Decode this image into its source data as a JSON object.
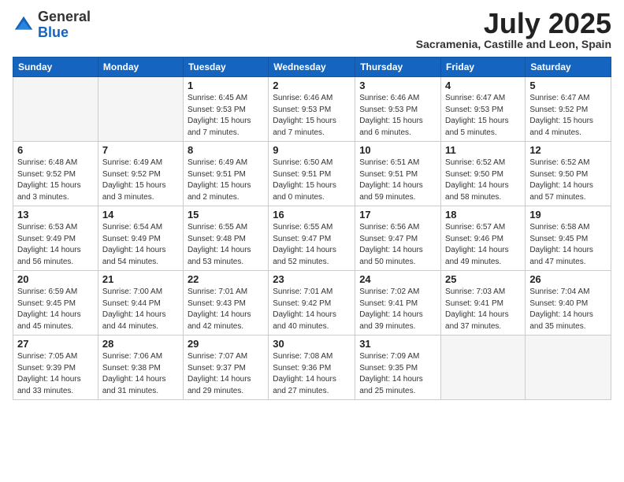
{
  "logo": {
    "general": "General",
    "blue": "Blue"
  },
  "header": {
    "month": "July 2025",
    "location": "Sacramenia, Castille and Leon, Spain"
  },
  "weekdays": [
    "Sunday",
    "Monday",
    "Tuesday",
    "Wednesday",
    "Thursday",
    "Friday",
    "Saturday"
  ],
  "weeks": [
    [
      {
        "day": "",
        "sunrise": "",
        "sunset": "",
        "daylight": "",
        "empty": true
      },
      {
        "day": "",
        "sunrise": "",
        "sunset": "",
        "daylight": "",
        "empty": true
      },
      {
        "day": "1",
        "sunrise": "Sunrise: 6:45 AM",
        "sunset": "Sunset: 9:53 PM",
        "daylight": "Daylight: 15 hours and 7 minutes."
      },
      {
        "day": "2",
        "sunrise": "Sunrise: 6:46 AM",
        "sunset": "Sunset: 9:53 PM",
        "daylight": "Daylight: 15 hours and 7 minutes."
      },
      {
        "day": "3",
        "sunrise": "Sunrise: 6:46 AM",
        "sunset": "Sunset: 9:53 PM",
        "daylight": "Daylight: 15 hours and 6 minutes."
      },
      {
        "day": "4",
        "sunrise": "Sunrise: 6:47 AM",
        "sunset": "Sunset: 9:53 PM",
        "daylight": "Daylight: 15 hours and 5 minutes."
      },
      {
        "day": "5",
        "sunrise": "Sunrise: 6:47 AM",
        "sunset": "Sunset: 9:52 PM",
        "daylight": "Daylight: 15 hours and 4 minutes."
      }
    ],
    [
      {
        "day": "6",
        "sunrise": "Sunrise: 6:48 AM",
        "sunset": "Sunset: 9:52 PM",
        "daylight": "Daylight: 15 hours and 3 minutes."
      },
      {
        "day": "7",
        "sunrise": "Sunrise: 6:49 AM",
        "sunset": "Sunset: 9:52 PM",
        "daylight": "Daylight: 15 hours and 3 minutes."
      },
      {
        "day": "8",
        "sunrise": "Sunrise: 6:49 AM",
        "sunset": "Sunset: 9:51 PM",
        "daylight": "Daylight: 15 hours and 2 minutes."
      },
      {
        "day": "9",
        "sunrise": "Sunrise: 6:50 AM",
        "sunset": "Sunset: 9:51 PM",
        "daylight": "Daylight: 15 hours and 0 minutes."
      },
      {
        "day": "10",
        "sunrise": "Sunrise: 6:51 AM",
        "sunset": "Sunset: 9:51 PM",
        "daylight": "Daylight: 14 hours and 59 minutes."
      },
      {
        "day": "11",
        "sunrise": "Sunrise: 6:52 AM",
        "sunset": "Sunset: 9:50 PM",
        "daylight": "Daylight: 14 hours and 58 minutes."
      },
      {
        "day": "12",
        "sunrise": "Sunrise: 6:52 AM",
        "sunset": "Sunset: 9:50 PM",
        "daylight": "Daylight: 14 hours and 57 minutes."
      }
    ],
    [
      {
        "day": "13",
        "sunrise": "Sunrise: 6:53 AM",
        "sunset": "Sunset: 9:49 PM",
        "daylight": "Daylight: 14 hours and 56 minutes."
      },
      {
        "day": "14",
        "sunrise": "Sunrise: 6:54 AM",
        "sunset": "Sunset: 9:49 PM",
        "daylight": "Daylight: 14 hours and 54 minutes."
      },
      {
        "day": "15",
        "sunrise": "Sunrise: 6:55 AM",
        "sunset": "Sunset: 9:48 PM",
        "daylight": "Daylight: 14 hours and 53 minutes."
      },
      {
        "day": "16",
        "sunrise": "Sunrise: 6:55 AM",
        "sunset": "Sunset: 9:47 PM",
        "daylight": "Daylight: 14 hours and 52 minutes."
      },
      {
        "day": "17",
        "sunrise": "Sunrise: 6:56 AM",
        "sunset": "Sunset: 9:47 PM",
        "daylight": "Daylight: 14 hours and 50 minutes."
      },
      {
        "day": "18",
        "sunrise": "Sunrise: 6:57 AM",
        "sunset": "Sunset: 9:46 PM",
        "daylight": "Daylight: 14 hours and 49 minutes."
      },
      {
        "day": "19",
        "sunrise": "Sunrise: 6:58 AM",
        "sunset": "Sunset: 9:45 PM",
        "daylight": "Daylight: 14 hours and 47 minutes."
      }
    ],
    [
      {
        "day": "20",
        "sunrise": "Sunrise: 6:59 AM",
        "sunset": "Sunset: 9:45 PM",
        "daylight": "Daylight: 14 hours and 45 minutes."
      },
      {
        "day": "21",
        "sunrise": "Sunrise: 7:00 AM",
        "sunset": "Sunset: 9:44 PM",
        "daylight": "Daylight: 14 hours and 44 minutes."
      },
      {
        "day": "22",
        "sunrise": "Sunrise: 7:01 AM",
        "sunset": "Sunset: 9:43 PM",
        "daylight": "Daylight: 14 hours and 42 minutes."
      },
      {
        "day": "23",
        "sunrise": "Sunrise: 7:01 AM",
        "sunset": "Sunset: 9:42 PM",
        "daylight": "Daylight: 14 hours and 40 minutes."
      },
      {
        "day": "24",
        "sunrise": "Sunrise: 7:02 AM",
        "sunset": "Sunset: 9:41 PM",
        "daylight": "Daylight: 14 hours and 39 minutes."
      },
      {
        "day": "25",
        "sunrise": "Sunrise: 7:03 AM",
        "sunset": "Sunset: 9:41 PM",
        "daylight": "Daylight: 14 hours and 37 minutes."
      },
      {
        "day": "26",
        "sunrise": "Sunrise: 7:04 AM",
        "sunset": "Sunset: 9:40 PM",
        "daylight": "Daylight: 14 hours and 35 minutes."
      }
    ],
    [
      {
        "day": "27",
        "sunrise": "Sunrise: 7:05 AM",
        "sunset": "Sunset: 9:39 PM",
        "daylight": "Daylight: 14 hours and 33 minutes."
      },
      {
        "day": "28",
        "sunrise": "Sunrise: 7:06 AM",
        "sunset": "Sunset: 9:38 PM",
        "daylight": "Daylight: 14 hours and 31 minutes."
      },
      {
        "day": "29",
        "sunrise": "Sunrise: 7:07 AM",
        "sunset": "Sunset: 9:37 PM",
        "daylight": "Daylight: 14 hours and 29 minutes."
      },
      {
        "day": "30",
        "sunrise": "Sunrise: 7:08 AM",
        "sunset": "Sunset: 9:36 PM",
        "daylight": "Daylight: 14 hours and 27 minutes."
      },
      {
        "day": "31",
        "sunrise": "Sunrise: 7:09 AM",
        "sunset": "Sunset: 9:35 PM",
        "daylight": "Daylight: 14 hours and 25 minutes."
      },
      {
        "day": "",
        "sunrise": "",
        "sunset": "",
        "daylight": "",
        "empty": true
      },
      {
        "day": "",
        "sunrise": "",
        "sunset": "",
        "daylight": "",
        "empty": true
      }
    ]
  ]
}
